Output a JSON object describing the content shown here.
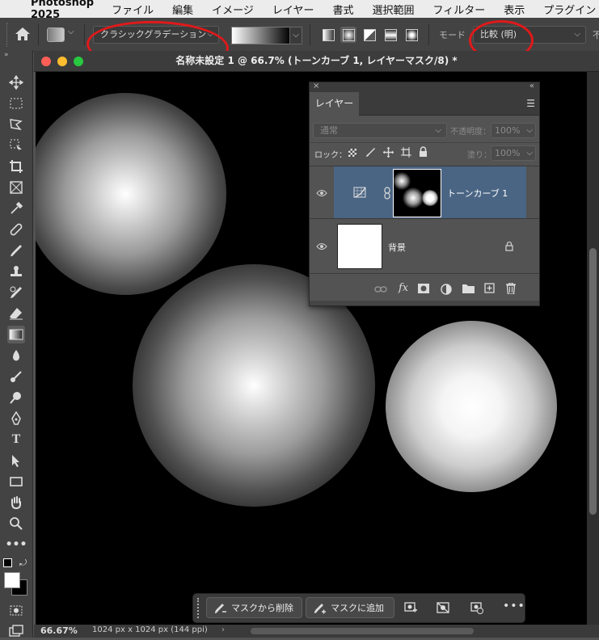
{
  "menu": {
    "app": "Photoshop 2025",
    "items": [
      "ファイル",
      "編集",
      "イメージ",
      "レイヤー",
      "書式",
      "選択範囲",
      "フィルター",
      "表示",
      "プラグイン"
    ]
  },
  "options": {
    "gradient_type": "クラシックグラデーション",
    "mode_label": "モード",
    "mode_value": "比較 (明)",
    "truncated_label": "不"
  },
  "document": {
    "title": "名称未設定 1 @ 66.7% (トーンカーブ 1, レイヤーマスク/8) *",
    "zoom": "66.67%",
    "dimensions": "1024 px x 1024 px (144 ppi)"
  },
  "layers_panel": {
    "tab": "レイヤー",
    "blend_mode": "通常",
    "opacity_label": "不透明度：",
    "opacity_value": "100%",
    "lock_label": "ロック：",
    "fill_label": "塗り：",
    "fill_value": "100%",
    "layers": [
      {
        "name": "トーンカーブ 1",
        "selected": true
      },
      {
        "name": "背景",
        "selected": false
      }
    ]
  },
  "context_bar": {
    "remove_label": "マスクから削除",
    "add_label": "マスクに追加"
  },
  "colors": {
    "annotation": "#e0191a",
    "selected_layer": "#4a6584",
    "panel": "#535353"
  }
}
